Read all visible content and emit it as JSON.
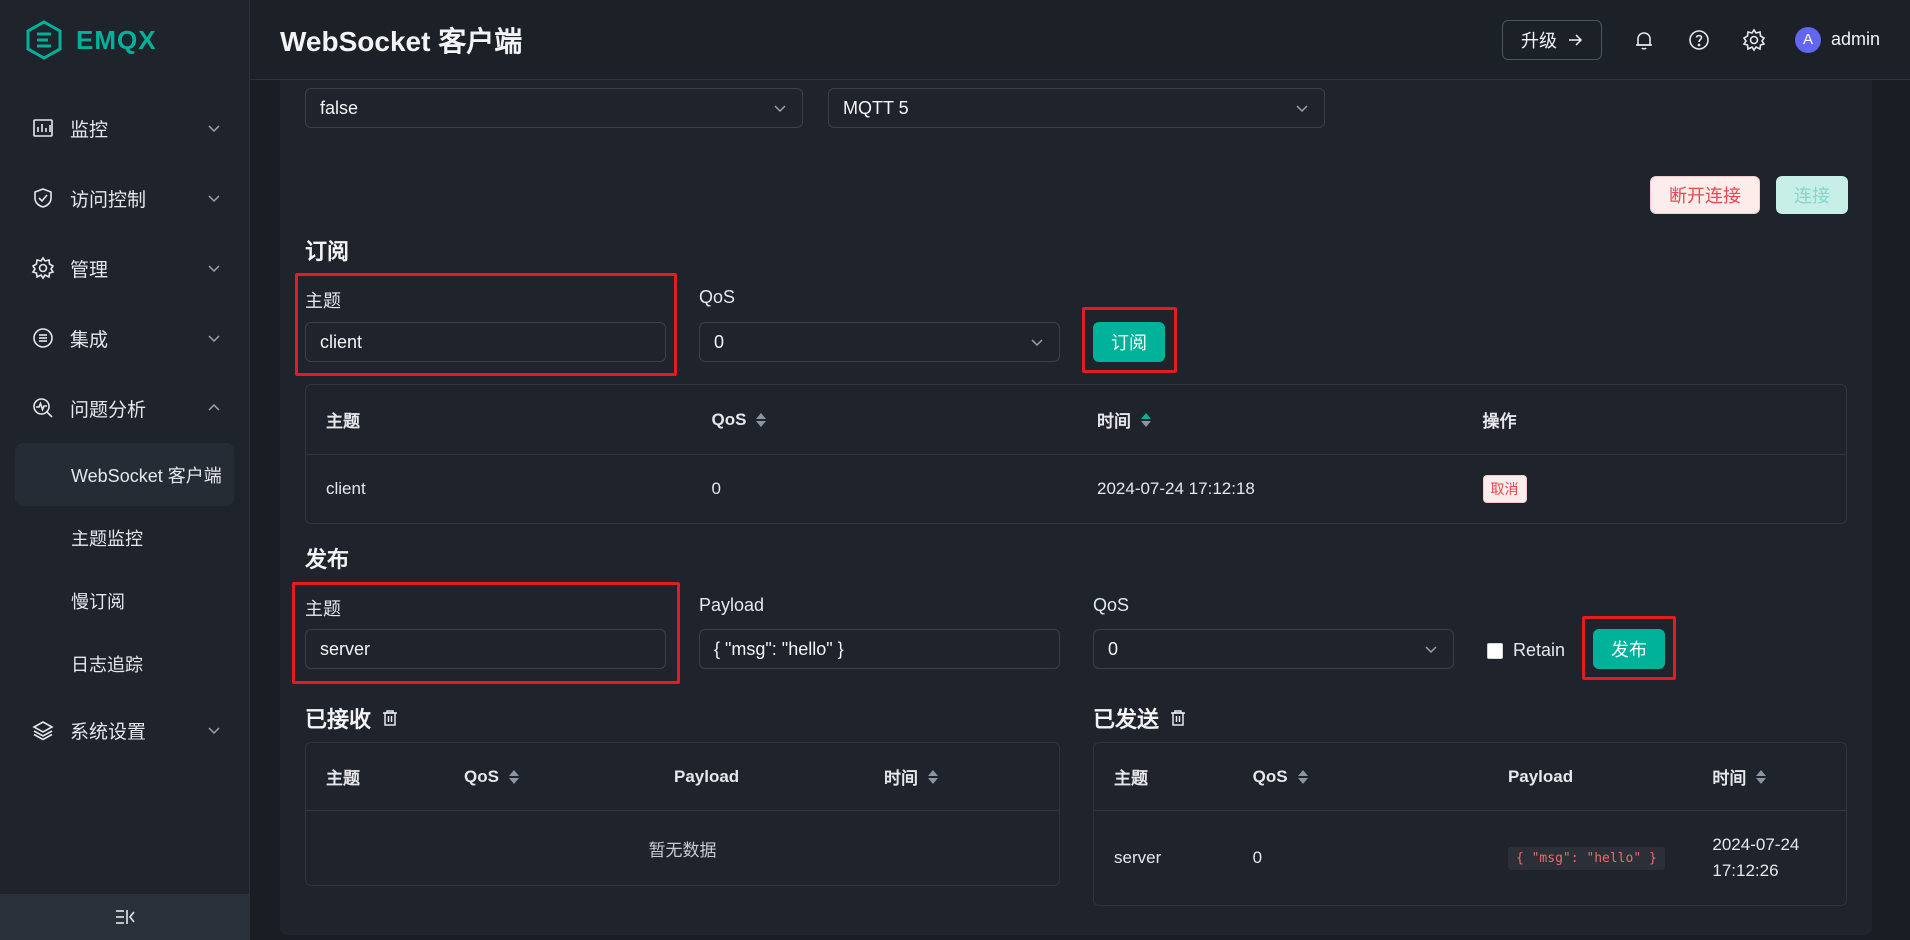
{
  "brand": {
    "name": "EMQX"
  },
  "sidebar": {
    "items": [
      {
        "label": "监控",
        "icon": "monitor-icon"
      },
      {
        "label": "访问控制",
        "icon": "shield-icon"
      },
      {
        "label": "管理",
        "icon": "gear-cog-icon"
      },
      {
        "label": "集成",
        "icon": "integration-icon"
      },
      {
        "label": "问题分析",
        "icon": "diagnose-icon"
      }
    ],
    "sub_items": [
      {
        "label": "WebSocket 客户端",
        "active": true
      },
      {
        "label": "主题监控"
      },
      {
        "label": "慢订阅"
      },
      {
        "label": "日志追踪"
      }
    ],
    "settings_item": {
      "label": "系统设置",
      "icon": "layers-icon"
    },
    "collapse_label": "⇤"
  },
  "header": {
    "title": "WebSocket 客户端",
    "upgrade_label": "升级",
    "user_initial": "A",
    "user_name": "admin"
  },
  "connection": {
    "clean_session_value": "false",
    "mqtt_version_value": "MQTT 5",
    "disconnect_label": "断开连接",
    "connect_label": "连接"
  },
  "subscribe": {
    "title": "订阅",
    "topic_label": "主题",
    "topic_value": "client",
    "qos_label": "QoS",
    "qos_value": "0",
    "button_label": "订阅",
    "table": {
      "headers": [
        "主题",
        "QoS",
        "时间",
        "操作"
      ],
      "rows": [
        {
          "topic": "client",
          "qos": "0",
          "time": "2024-07-24 17:12:18",
          "action": "取消"
        }
      ]
    }
  },
  "publish": {
    "title": "发布",
    "topic_label": "主题",
    "topic_value": "server",
    "payload_label": "Payload",
    "payload_value": "{ \"msg\": \"hello\" }",
    "qos_label": "QoS",
    "qos_value": "0",
    "retain_label": "Retain",
    "button_label": "发布"
  },
  "received": {
    "title": "已接收",
    "headers": [
      "主题",
      "QoS",
      "Payload",
      "时间"
    ],
    "empty_text": "暂无数据"
  },
  "sent": {
    "title": "已发送",
    "headers": [
      "主题",
      "QoS",
      "Payload",
      "时间"
    ],
    "rows": [
      {
        "topic": "server",
        "qos": "0",
        "payload": "{ \"msg\": \"hello\" }",
        "time_date": "2024-07-24",
        "time_clock": "17:12:26"
      }
    ]
  },
  "colors": {
    "accent": "#00b299",
    "danger": "#e5484d",
    "highlight": "#e11d1d"
  }
}
